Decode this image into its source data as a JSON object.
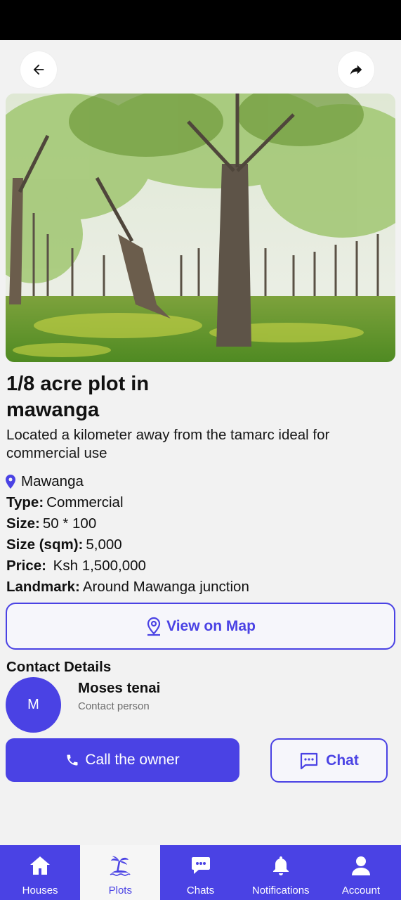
{
  "colors": {
    "accent": "#4a42e4",
    "background": "#f2f2f2"
  },
  "header": {
    "back_icon": "arrow-left-icon",
    "share_icon": "share-icon"
  },
  "listing": {
    "title": "1/8 acre plot in mawanga",
    "description": "Located a kilometer away from the tamarc ideal for commercial use",
    "location": "Mawanga",
    "details": [
      {
        "key": "Type:",
        "value": "Commercial"
      },
      {
        "key": "Size:",
        "value": "50 * 100"
      },
      {
        "key": "Size (sqm):",
        "value": "5,000"
      },
      {
        "key": "Price:",
        "value": " Ksh 1,500,000"
      },
      {
        "key": "Landmark:",
        "value": "Around Mawanga junction"
      }
    ]
  },
  "actions": {
    "view_map_label": "View on Map",
    "call_label": "Call the owner",
    "chat_label": "Chat"
  },
  "contact": {
    "heading": "Contact Details",
    "initial": "M",
    "name": "Moses tenai",
    "role": "Contact person"
  },
  "nav": {
    "items": [
      {
        "label": "Houses",
        "icon": "home-icon",
        "active": false
      },
      {
        "label": "Plots",
        "icon": "island-icon",
        "active": true
      },
      {
        "label": "Chats",
        "icon": "chat-bubble-icon",
        "active": false
      },
      {
        "label": "Notifications",
        "icon": "bell-icon",
        "active": false
      },
      {
        "label": "Account",
        "icon": "user-icon",
        "active": false
      }
    ]
  }
}
